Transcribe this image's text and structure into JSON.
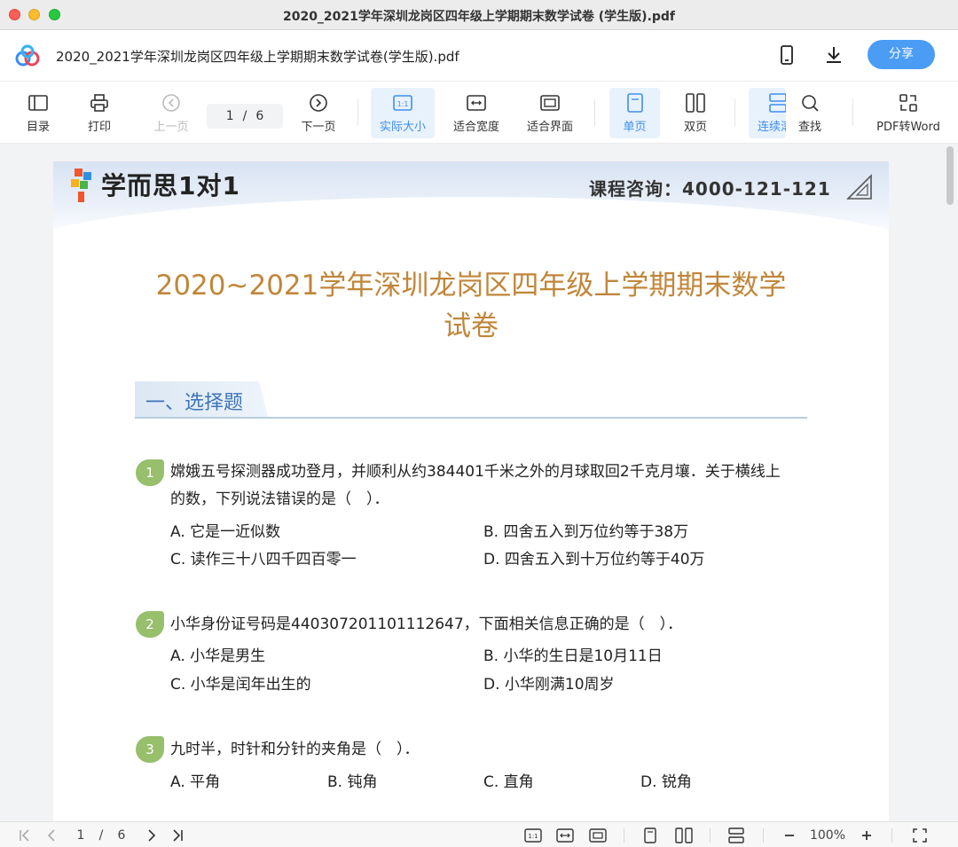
{
  "window": {
    "title": "2020_2021学年深圳龙岗区四年级上学期期末数学试卷 (学生版).pdf"
  },
  "header": {
    "filename": "2020_2021学年深圳龙岗区四年级上学期期末数学试卷(学生版).pdf",
    "share_label": "分享",
    "icons": [
      "mobile-icon",
      "download-icon"
    ]
  },
  "toolbar": {
    "toc": "目录",
    "print": "打印",
    "prev": "上一页",
    "current_page": "1",
    "separator": "/",
    "total_pages": "6",
    "next": "下一页",
    "actual_size": "实际大小",
    "fit_width": "适合宽度",
    "fit_page": "适合界面",
    "single": "单页",
    "double": "双页",
    "continuous": "连续滚动",
    "find": "查找",
    "pdf_to_word": "PDF转Word"
  },
  "document": {
    "brand": "学而思1对1",
    "consult": "课程咨询：4000-121-121",
    "title_line1": "2020~2021学年深圳龙岗区四年级上学期期末数学",
    "title_line2": "试卷",
    "section": "一、选择题",
    "questions": [
      {
        "num": "1",
        "line1": "嫦娥五号探测器成功登月，并顺利从约384401千米之外的月球取回2千克月壤．关于横线上",
        "line2": "的数，下列说法错误的是（　）．",
        "options": [
          "A. 它是一近似数",
          "B. 四舍五入到万位约等于38万",
          "C. 读作三十八四千四百零一",
          "D. 四舍五入到十万位约等于40万"
        ]
      },
      {
        "num": "2",
        "line1": "小华身份证号码是440307201101112647，下面相关信息正确的是（　）．",
        "options": [
          "A. 小华是男生",
          "B. 小华的生日是10月11日",
          "C. 小华是闰年出生的",
          "D. 小华刚满10周岁"
        ]
      },
      {
        "num": "3",
        "line1": "九时半，时针和分针的夹角是（　）．",
        "options": [
          "A. 平角",
          "B. 钝角",
          "C. 直角",
          "D. 锐角"
        ]
      }
    ]
  },
  "statusbar": {
    "current_page": "1",
    "separator": "/",
    "total_pages": "6",
    "zoom": "100%"
  },
  "colors": {
    "accent": "#4a9cf5",
    "title": "#c0863a",
    "section": "#3e74b8",
    "qbadge": "#97bf6c"
  }
}
